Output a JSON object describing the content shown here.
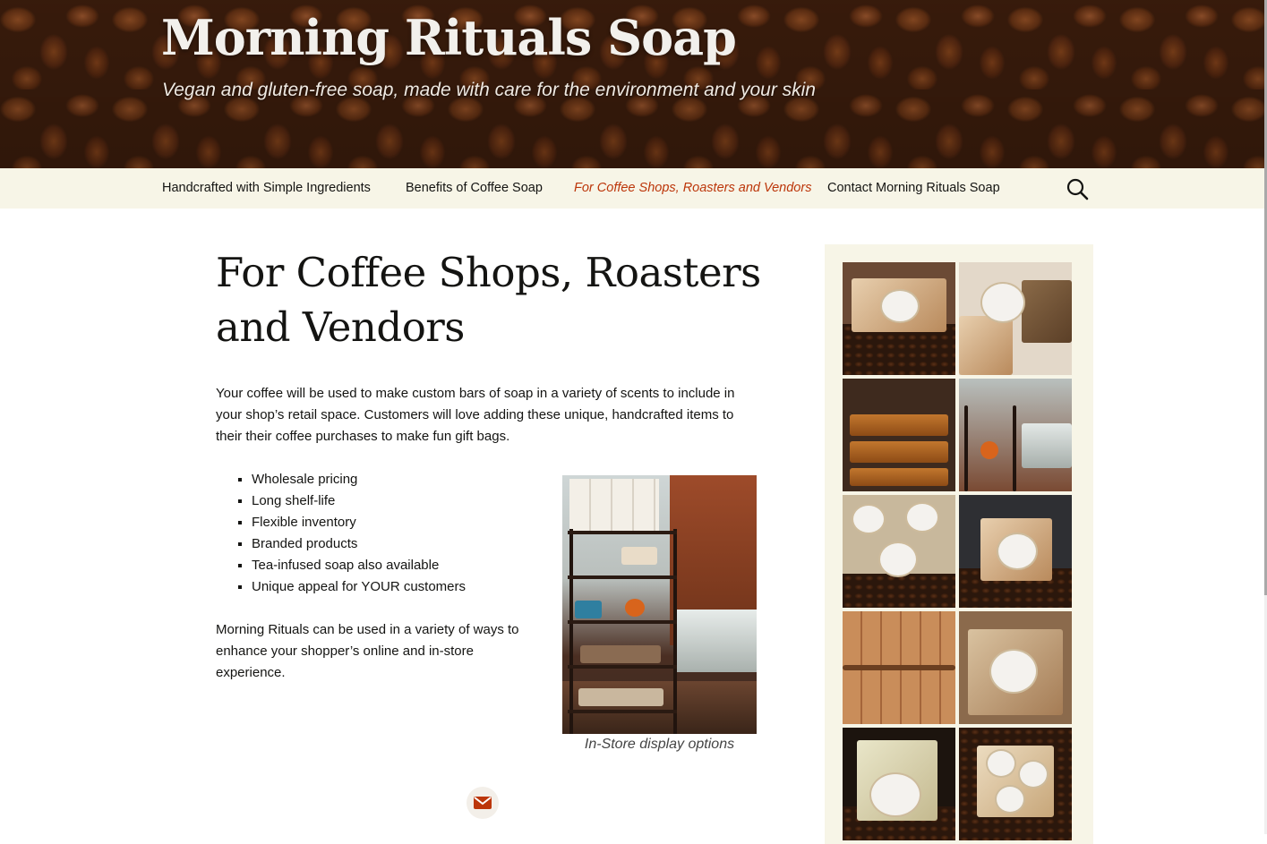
{
  "site": {
    "title": "Morning Rituals Soap",
    "description": "Vegan and gluten-free soap, made with care for the environment and your skin"
  },
  "nav": {
    "items": [
      {
        "label": "Handcrafted with Simple Ingredients",
        "active": false
      },
      {
        "label": "Benefits of Coffee Soap",
        "active": false
      },
      {
        "label": "For Coffee Shops, Roasters and Vendors",
        "active": true
      },
      {
        "label": "Contact Morning Rituals Soap",
        "active": false
      }
    ],
    "search_icon": "search-icon"
  },
  "page": {
    "title": "For Coffee Shops, Roasters and Vendors",
    "intro": "Your coffee will be used to make custom bars of soap in a variety of scents to include in your shop’s retail space. Customers will love adding these unique, handcrafted items to their their coffee purchases to make fun gift bags.",
    "features": [
      "Wholesale pricing",
      "Long shelf-life",
      "Flexible inventory",
      "Branded products",
      "Tea-infused soap also available",
      "Unique appeal for YOUR customers"
    ],
    "outro": "Morning Rituals can be used in a variety of ways to enhance your shopper’s online and in-store experience.",
    "figure_caption": "In-Store display options",
    "share_icon": "email-icon"
  },
  "colors": {
    "accent": "#bc360a",
    "navbar_bg": "#f7f5e7",
    "sidebar_bg": "#f7f5e7",
    "text": "#141412"
  },
  "gallery": {
    "count": 10,
    "icon": "photo-thumbnail"
  }
}
